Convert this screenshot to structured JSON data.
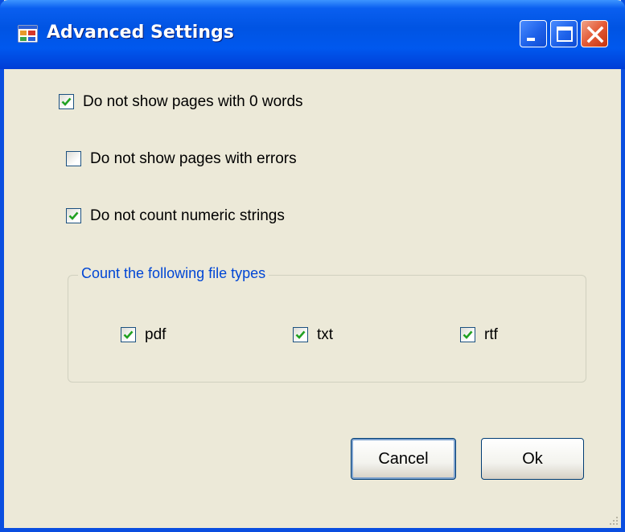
{
  "window": {
    "title": "Advanced Settings",
    "icon": "app-window-icon",
    "controls": {
      "minimize": "minimize-icon",
      "maximize": "maximize-icon",
      "close": "close-icon"
    }
  },
  "options": [
    {
      "label": "Do not show pages with 0 words",
      "checked": true
    },
    {
      "label": "Do not show pages with errors",
      "checked": false
    },
    {
      "label": "Do not count numeric strings",
      "checked": true
    }
  ],
  "file_types": {
    "legend": "Count the following file types",
    "items": [
      {
        "label": "pdf",
        "checked": true
      },
      {
        "label": "txt",
        "checked": true
      },
      {
        "label": "rtf",
        "checked": true
      }
    ]
  },
  "buttons": {
    "cancel": "Cancel",
    "ok": "Ok"
  },
  "colors": {
    "title_bar": "#0054e3",
    "window_bg": "#ece9d8",
    "group_legend": "#0046d5",
    "checkmark": "#21a121",
    "close_button": "#e45a36"
  }
}
